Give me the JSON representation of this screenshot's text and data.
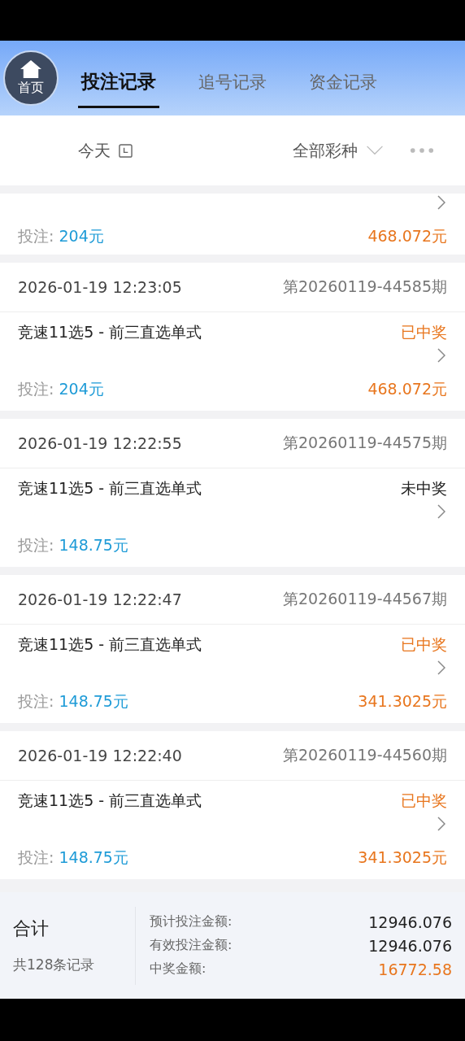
{
  "home_button": {
    "label": "首页"
  },
  "tabs": [
    {
      "label": "投注记录",
      "selected": true
    },
    {
      "label": "追号记录",
      "selected": false
    },
    {
      "label": "资金记录",
      "selected": false
    }
  ],
  "filters": {
    "date": "今天",
    "lottery": "全部彩种"
  },
  "partial_record": {
    "stake_label": "投注:",
    "stake": "204元",
    "winnings": "468.072元"
  },
  "records": [
    {
      "time": "2026-01-19 12:23:05",
      "period": "第20260119-44585期",
      "title": "竞速11选5 - 前三直选单式",
      "status": "已中奖",
      "won": true,
      "stake_label": "投注:",
      "stake": "204元",
      "winnings": "468.072元"
    },
    {
      "time": "2026-01-19 12:22:55",
      "period": "第20260119-44575期",
      "title": "竞速11选5 - 前三直选单式",
      "status": "未中奖",
      "won": false,
      "stake_label": "投注:",
      "stake": "148.75元"
    },
    {
      "time": "2026-01-19 12:22:47",
      "period": "第20260119-44567期",
      "title": "竞速11选5 - 前三直选单式",
      "status": "已中奖",
      "won": true,
      "stake_label": "投注:",
      "stake": "148.75元",
      "winnings": "341.3025元"
    },
    {
      "time": "2026-01-19 12:22:40",
      "period": "第20260119-44560期",
      "title": "竞速11选5 - 前三直选单式",
      "status": "已中奖",
      "won": true,
      "stake_label": "投注:",
      "stake": "148.75元",
      "winnings": "341.3025元"
    }
  ],
  "summary": {
    "title": "合计",
    "count": "共128条记录",
    "rows": [
      {
        "label": "预计投注金额:",
        "value": "12946.076",
        "kind": "plain"
      },
      {
        "label": "有效投注金额:",
        "value": "12946.076",
        "kind": "plain"
      },
      {
        "label": "中奖金额:",
        "value": "16772.58",
        "kind": "highlight"
      }
    ]
  }
}
